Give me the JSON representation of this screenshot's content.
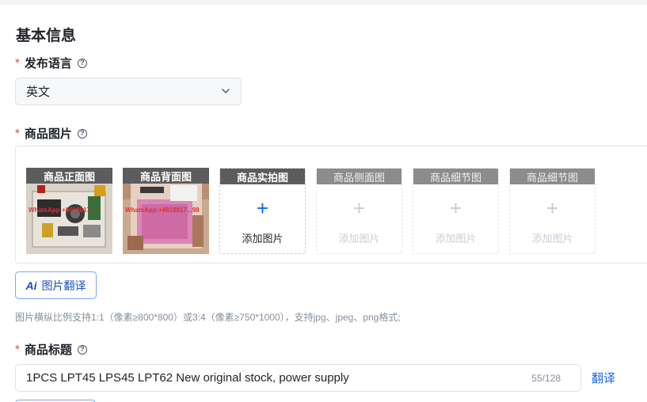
{
  "section": {
    "title": "基本信息"
  },
  "language": {
    "label": "发布语言",
    "required_mark": "*",
    "help": "?",
    "value": "英文"
  },
  "images": {
    "label": "商品图片",
    "required_mark": "*",
    "help": "?",
    "slots": [
      {
        "tag": "商品正面图",
        "state": "filled",
        "watermark": "WhatsApp:+8618817..."
      },
      {
        "tag": "商品背面图",
        "state": "filled",
        "watermark": "WhatsApp:+8618817...98"
      },
      {
        "tag": "商品实拍图",
        "state": "add-active",
        "add_label": "添加图片",
        "plus": "+"
      },
      {
        "tag": "商品侧面图",
        "state": "add-disabled",
        "add_label": "添加图片",
        "plus": "+"
      },
      {
        "tag": "商品细节图",
        "state": "add-disabled",
        "add_label": "添加图片",
        "plus": "+"
      },
      {
        "tag": "商品细节图",
        "state": "add-disabled",
        "add_label": "添加图片",
        "plus": "+"
      }
    ],
    "translate_button": {
      "icon": "Ai",
      "label": "图片翻译"
    },
    "hint": "图片横纵比例支持1:1（像素≥800*800）或3:4（像素≥750*1000），支持jpg、jpeg、png格式;"
  },
  "product_title": {
    "label": "商品标题",
    "required_mark": "*",
    "help": "?",
    "value": "1PCS LPT45 LPS45 LPT62 New original stock, power supply",
    "count": "55/128",
    "translate_link": "翻译"
  },
  "colors": {
    "accent": "#1664ff",
    "required": "#e5484d",
    "tag_active": "#5c5c5c",
    "tag_disabled": "#8c8c8c"
  }
}
